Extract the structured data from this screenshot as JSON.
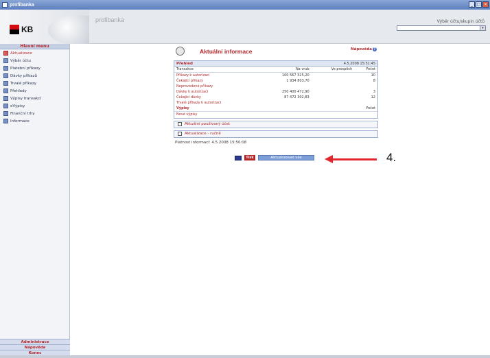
{
  "window": {
    "title": "profibanka"
  },
  "header": {
    "logo_text": "KB",
    "brand": "profibanka",
    "account_label": "Výběr účtu/skupin účtů"
  },
  "sidebar": {
    "heading": "Hlavní menu",
    "items": [
      {
        "label": "Aktualizace",
        "icon": "refresh-icon"
      },
      {
        "label": "Výběr účtu",
        "icon": "account-icon"
      },
      {
        "label": "Platební příkazy",
        "icon": "payment-icon"
      },
      {
        "label": "Dávky příkazů",
        "icon": "batch-icon"
      },
      {
        "label": "Trvalé příkazy",
        "icon": "standing-order-icon"
      },
      {
        "label": "Přehledy",
        "icon": "overview-icon"
      },
      {
        "label": "Výpisy transakcí",
        "icon": "statement-icon"
      },
      {
        "label": "eVýpisy",
        "icon": "estatement-icon"
      },
      {
        "label": "Finanční trhy",
        "icon": "markets-icon"
      },
      {
        "label": "Informace",
        "icon": "info-icon"
      }
    ],
    "bottom": [
      "Administrace",
      "Nápověda",
      "Konec"
    ]
  },
  "panel": {
    "title": "Aktuální informace",
    "help": "Nápověda",
    "overview": {
      "title": "Přehled",
      "datetime": "4.5.2008 15:51:45",
      "columns": [
        "Transakce",
        "Na vrub",
        "Ve prospěch",
        "Počet"
      ],
      "rows": [
        [
          "Příkazy k autorizaci",
          "100 567 525,20",
          "",
          "10"
        ],
        [
          "Čekající příkazy",
          "1 934 803,70",
          "",
          "8"
        ],
        [
          "Neprovedené příkazy",
          "",
          "",
          ""
        ],
        [
          "Dávky k autorizaci",
          "250 400 472,90",
          "",
          "3"
        ],
        [
          "Čekající dávky",
          "87 472 302,83",
          "",
          "12"
        ],
        [
          "Trvalé příkazy k autorizaci",
          "",
          "",
          ""
        ]
      ]
    },
    "statements": {
      "title": "Výpisy",
      "count_label": "Počet",
      "link": "Nové výpisy"
    },
    "check_accounts": "Aktuální používaný účet",
    "check_refresh": "Aktualizace - ručně",
    "validity": "Platnost informací: 4.5.2008 15:50:08",
    "print_button": "Tisk",
    "refresh_button": "Aktualizovat vše",
    "step": "4."
  }
}
